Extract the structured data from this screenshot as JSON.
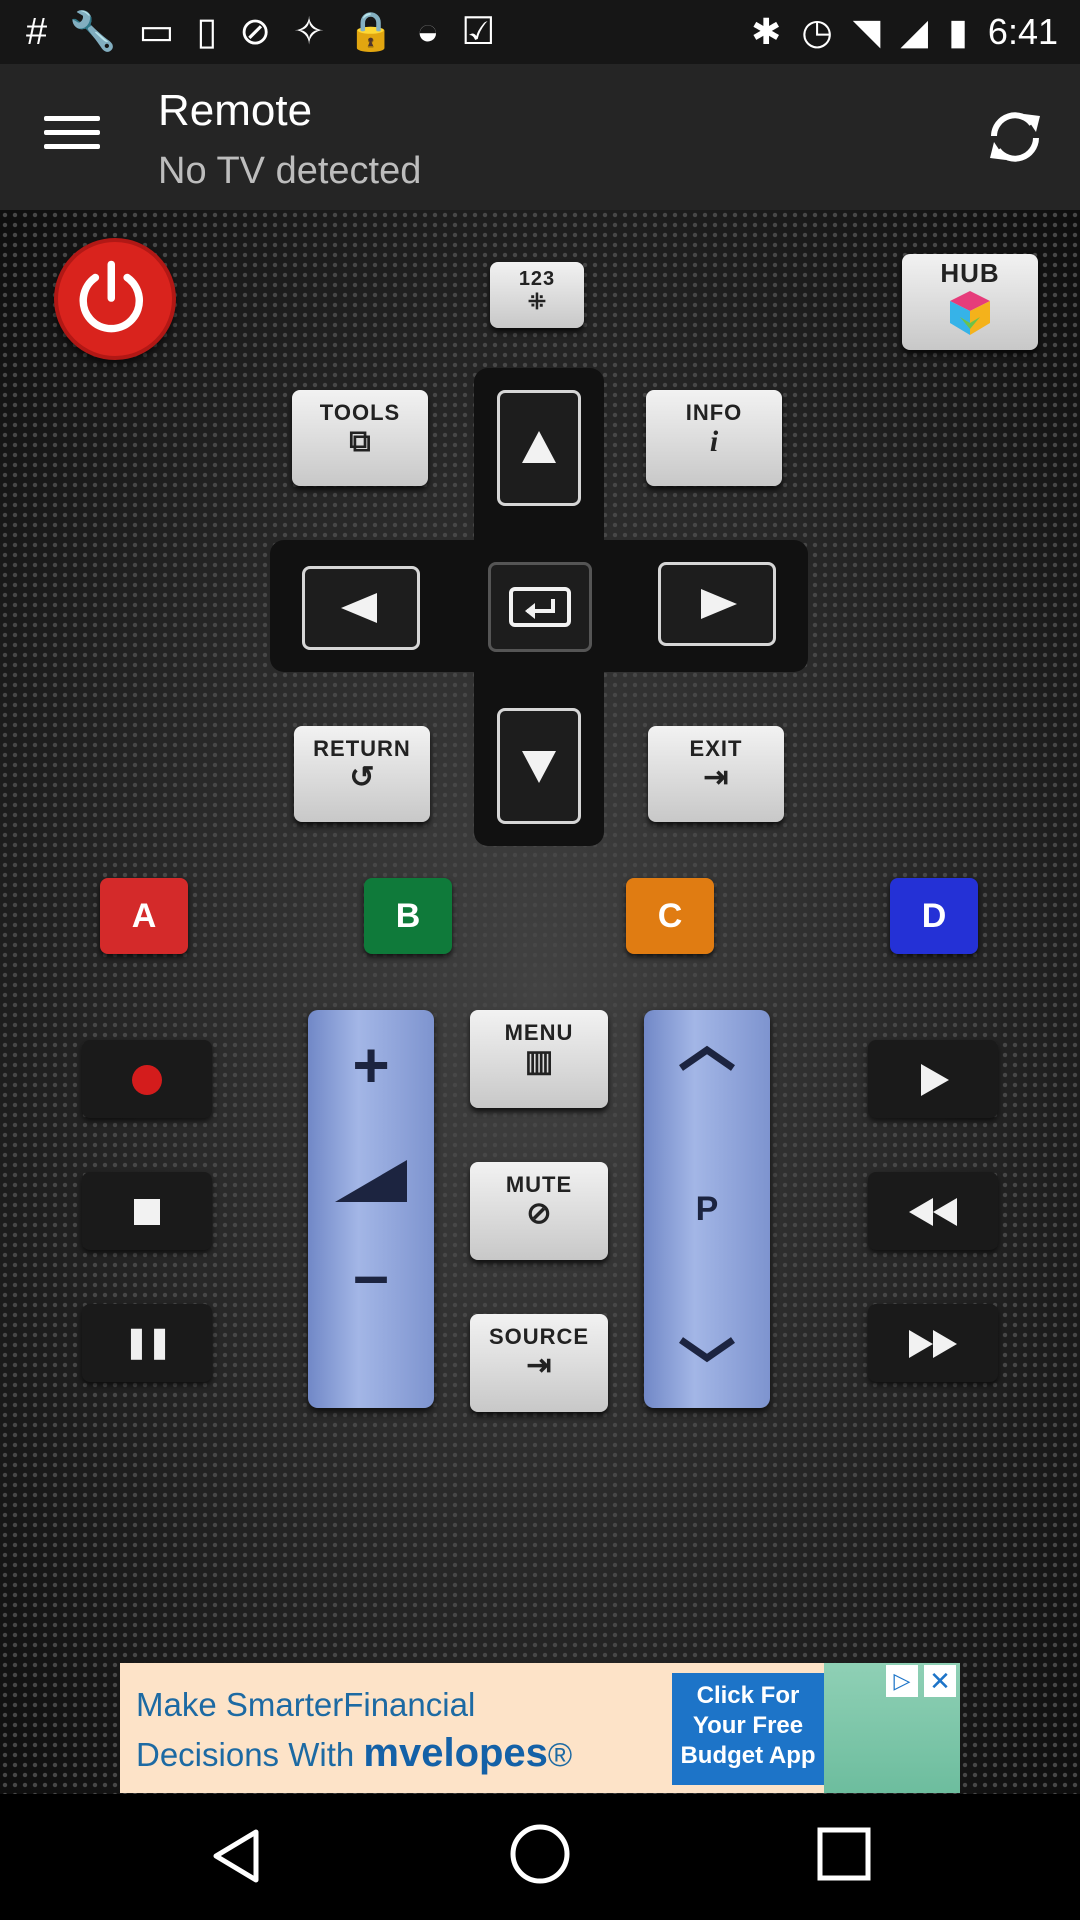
{
  "status": {
    "time": "6:41"
  },
  "appbar": {
    "title": "Remote",
    "subtitle": "No TV detected"
  },
  "remote": {
    "keypad_label": "123",
    "hub_label": "HUB",
    "tools_label": "TOOLS",
    "info_label": "INFO",
    "return_label": "RETURN",
    "exit_label": "EXIT",
    "color_a": "A",
    "color_b": "B",
    "color_c": "C",
    "color_d": "D",
    "menu_label": "MENU",
    "mute_label": "MUTE",
    "source_label": "SOURCE",
    "channel_label": "P",
    "colors": {
      "a": "#d42a2a",
      "b": "#0f7a3a",
      "c": "#e07c12",
      "d": "#2431d6",
      "power": "#d9231d",
      "rocker": "#a3b6e6"
    }
  },
  "ad": {
    "line1": "Make SmarterFinancial",
    "line2_prefix": "Decisions With ",
    "brand": "mvelopes",
    "brand_suffix": "®",
    "cta": "Click For Your Free Budget App"
  }
}
